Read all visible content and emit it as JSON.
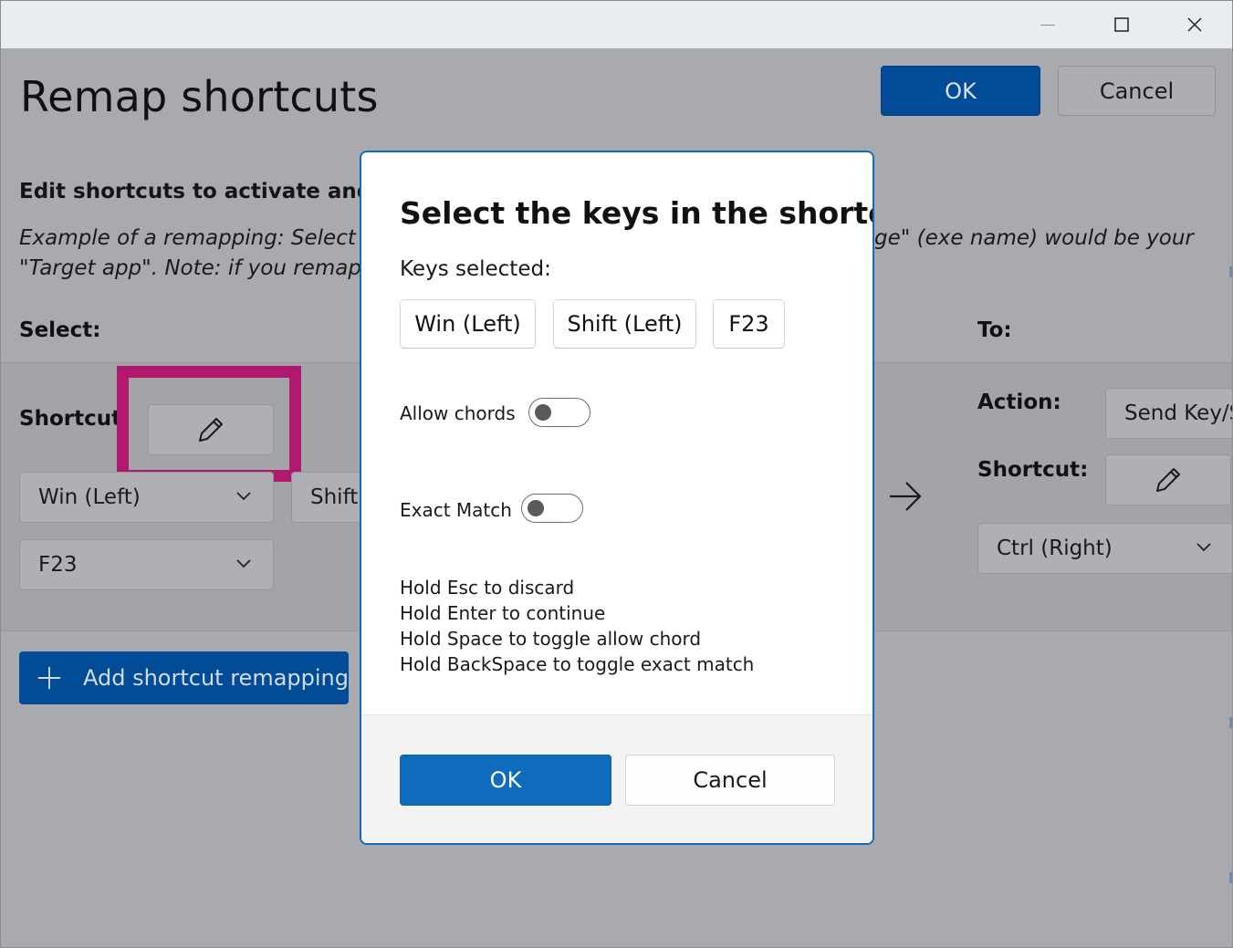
{
  "window": {
    "title_bar": {
      "minimize_icon": "minimize-icon",
      "maximize_icon": "maximize-icon",
      "close_icon": "close-icon"
    }
  },
  "page": {
    "title": "Remap shortcuts",
    "ok_label": "OK",
    "cancel_label": "Cancel",
    "subtitle": "Edit shortcuts to activate and ther",
    "example_line1_left": "Example of a remapping: Select \"Alt",
    "example_line1_right": "ge\" (exe name) would be your",
    "example_line2_left": "\"Target app\". Note: if you remapped",
    "select_label": "Select:",
    "to_label": "To:",
    "shortcut_label": "Shortcut:",
    "select_keys": [
      "Win (Left)",
      "Shift",
      "F23"
    ],
    "action_label": "Action:",
    "action_value": "Send Key/S",
    "target_shortcut_label": "Shortcut:",
    "target_key": "Ctrl (Right)",
    "add_button_label": "Add shortcut remapping"
  },
  "dialog": {
    "title": "Select the keys in the shortcut",
    "keys_selected_label": "Keys selected:",
    "keys": [
      "Win (Left)",
      "Shift (Left)",
      "F23"
    ],
    "allow_chords_label": "Allow chords",
    "allow_chords_on": false,
    "exact_match_label": "Exact Match",
    "exact_match_on": false,
    "hints": [
      "Hold Esc to discard",
      "Hold Enter to continue",
      "Hold Space to toggle allow chord",
      "Hold BackSpace to toggle exact match"
    ],
    "ok_label": "OK",
    "cancel_label": "Cancel"
  },
  "colors": {
    "accent": "#0f6cbd",
    "dimmed_accent": "#024b96",
    "highlight_box": "#b1186f",
    "overlay_background": "#a8aaaf"
  }
}
